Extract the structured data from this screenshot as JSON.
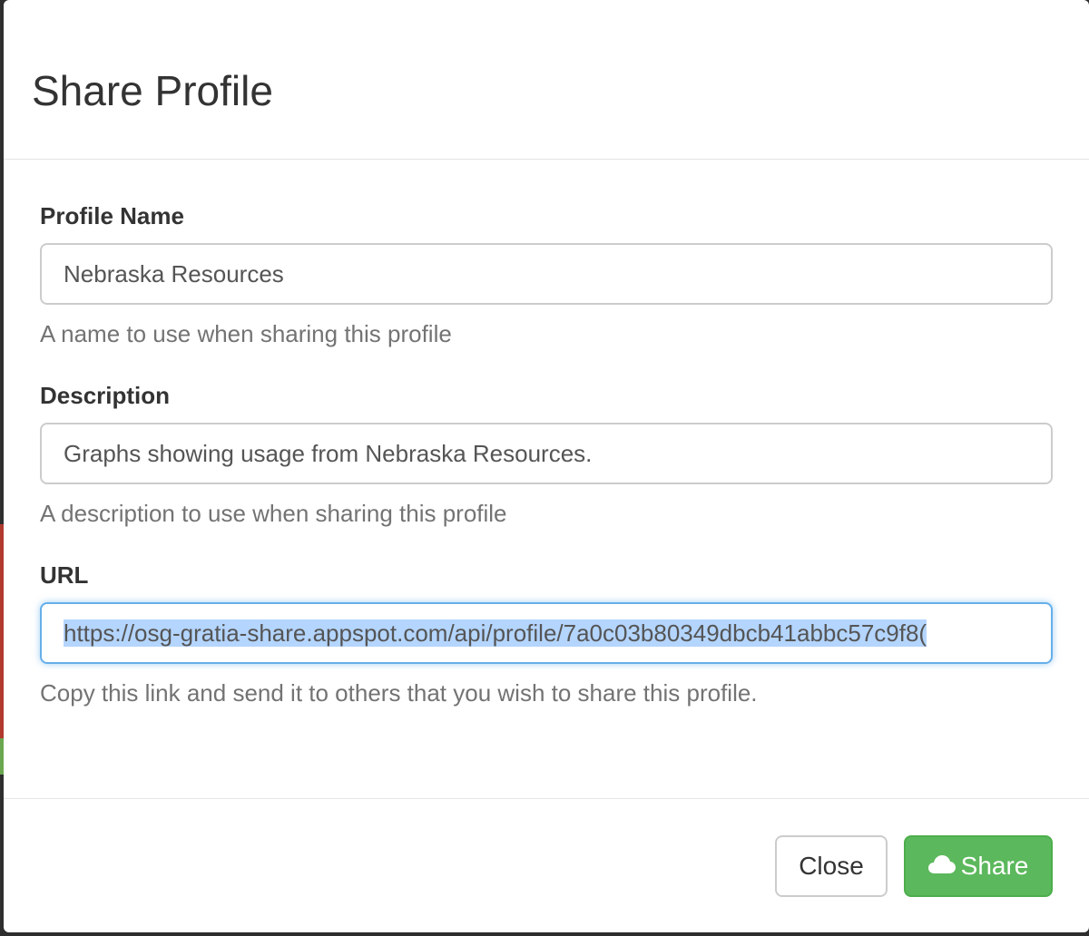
{
  "modal": {
    "title": "Share Profile"
  },
  "form": {
    "profile_name": {
      "label": "Profile Name",
      "value": "Nebraska Resources",
      "help": "A name to use when sharing this profile"
    },
    "description": {
      "label": "Description",
      "value": "Graphs showing usage from Nebraska Resources.",
      "help": "A description to use when sharing this profile"
    },
    "url": {
      "label": "URL",
      "value": "https://osg-gratia-share.appspot.com/api/profile/7a0c03b80349dbcb41abbc57c9f8(",
      "help": "Copy this link and send it to others that you wish to share this profile."
    }
  },
  "footer": {
    "close_label": "Close",
    "share_label": "Share"
  },
  "icons": {
    "share": "cloud-icon"
  },
  "colors": {
    "share_button": "#5cb85c",
    "focus_border": "#66afe9",
    "selection": "#b4d5fe"
  }
}
